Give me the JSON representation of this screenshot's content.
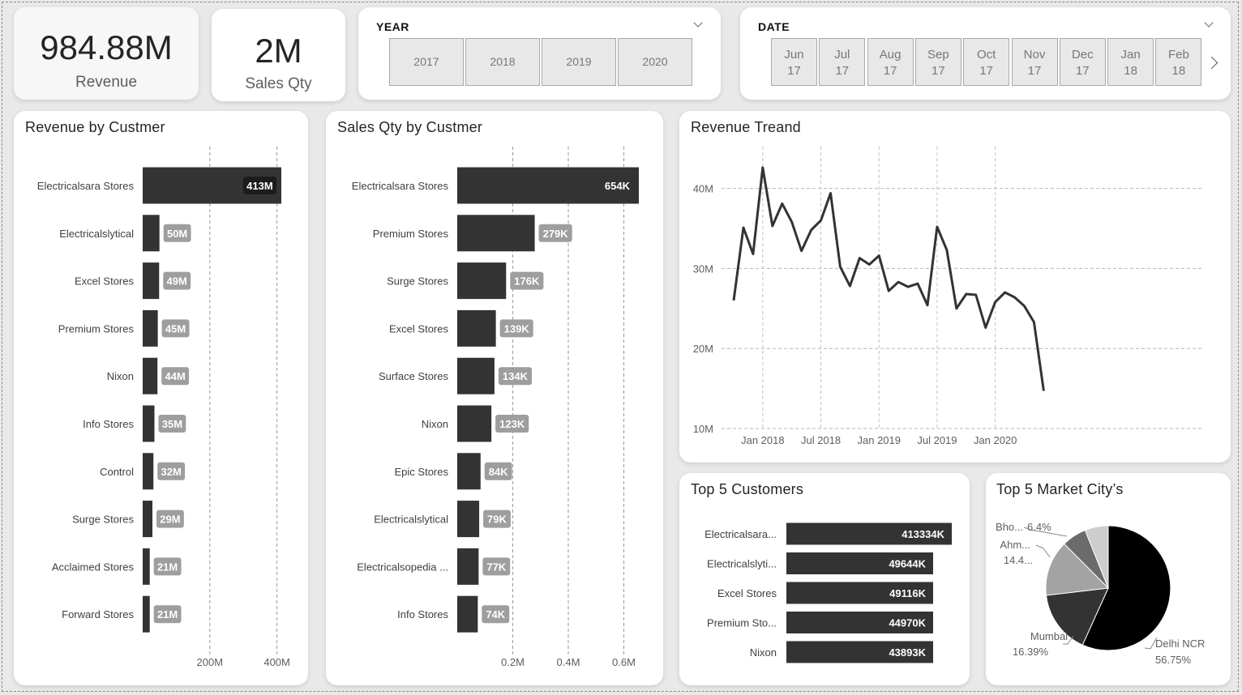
{
  "kpis": {
    "revenue": {
      "value": "984.88M",
      "label": "Revenue"
    },
    "sales_qty": {
      "value": "2M",
      "label": "Sales Qty"
    }
  },
  "year_slicer": {
    "title": "YEAR",
    "options": [
      "2017",
      "2018",
      "2019",
      "2020"
    ]
  },
  "date_slicer": {
    "title": "DATE",
    "options": [
      {
        "month": "Jun",
        "year": "17"
      },
      {
        "month": "Jul",
        "year": "17"
      },
      {
        "month": "Aug",
        "year": "17"
      },
      {
        "month": "Sep",
        "year": "17"
      },
      {
        "month": "Oct",
        "year": "17"
      },
      {
        "month": "Nov",
        "year": "17"
      },
      {
        "month": "Dec",
        "year": "17"
      },
      {
        "month": "Jan",
        "year": "18"
      },
      {
        "month": "Feb",
        "year": "18"
      }
    ]
  },
  "colors": {
    "bar": "#333333",
    "label_bg": "#9e9e9e",
    "pie_dark": "#000000"
  },
  "chart_data": [
    {
      "id": "revenue_by_customer",
      "type": "bar",
      "orientation": "horizontal",
      "title": "Revenue by Custmer",
      "categories": [
        "Electricalsara Stores",
        "Electricalslytical",
        "Excel Stores",
        "Premium Stores",
        "Nixon",
        "Info Stores",
        "Control",
        "Surge Stores",
        "Acclaimed Stores",
        "Forward Stores"
      ],
      "values": [
        413,
        50,
        49,
        45,
        44,
        35,
        32,
        29,
        21,
        21
      ],
      "value_labels": [
        "413M",
        "50M",
        "49M",
        "45M",
        "44M",
        "35M",
        "32M",
        "29M",
        "21M",
        "21M"
      ],
      "unit": "M",
      "xlim": [
        0,
        413
      ],
      "xticks": [
        {
          "v": 200,
          "label": "200M"
        },
        {
          "v": 400,
          "label": "400M"
        }
      ],
      "grid": true
    },
    {
      "id": "sales_qty_by_customer",
      "type": "bar",
      "orientation": "horizontal",
      "title": "Sales Qty by Custmer",
      "categories": [
        "Electricalsara Stores",
        "Premium Stores",
        "Surge Stores",
        "Excel Stores",
        "Surface Stores",
        "Nixon",
        "Epic Stores",
        "Electricalslytical",
        "Electricalsopedia ...",
        "Info Stores"
      ],
      "values": [
        654,
        279,
        176,
        139,
        134,
        123,
        84,
        79,
        77,
        74
      ],
      "value_labels": [
        "654K",
        "279K",
        "176K",
        "139K",
        "134K",
        "123K",
        "84K",
        "79K",
        "77K",
        "74K"
      ],
      "unit": "K",
      "xlim": [
        0,
        654
      ],
      "xticks": [
        {
          "v": 200,
          "label": "0.2M"
        },
        {
          "v": 400,
          "label": "0.4M"
        },
        {
          "v": 600,
          "label": "0.6M"
        }
      ],
      "grid": true
    },
    {
      "id": "revenue_trend",
      "type": "line",
      "title": "Revenue Treand",
      "x": [
        "2017-10",
        "2017-11",
        "2017-12",
        "2018-01",
        "2018-02",
        "2018-03",
        "2018-04",
        "2018-05",
        "2018-06",
        "2018-07",
        "2018-08",
        "2018-09",
        "2018-10",
        "2018-11",
        "2018-12",
        "2019-01",
        "2019-02",
        "2019-03",
        "2019-04",
        "2019-05",
        "2019-06",
        "2019-07",
        "2019-08",
        "2019-09",
        "2019-10",
        "2019-11",
        "2019-12",
        "2020-01",
        "2020-02",
        "2020-03",
        "2020-04",
        "2020-05",
        "2020-06"
      ],
      "y": [
        26.0,
        35.1,
        31.8,
        42.6,
        35.3,
        38.1,
        35.8,
        32.2,
        34.8,
        36.0,
        39.4,
        30.2,
        27.8,
        31.3,
        30.5,
        31.6,
        27.2,
        28.3,
        27.7,
        28.1,
        25.4,
        35.2,
        32.3,
        25.0,
        26.8,
        26.7,
        22.6,
        25.8,
        27.0,
        26.4,
        25.3,
        23.3,
        14.7
      ],
      "ylim": [
        10,
        45
      ],
      "yticks": [
        {
          "v": 10,
          "label": "10M"
        },
        {
          "v": 20,
          "label": "20M"
        },
        {
          "v": 30,
          "label": "30M"
        },
        {
          "v": 40,
          "label": "40M"
        }
      ],
      "xticks": [
        {
          "v": "2018-01",
          "label": "Jan 2018"
        },
        {
          "v": "2018-07",
          "label": "Jul 2018"
        },
        {
          "v": "2019-01",
          "label": "Jan 2019"
        },
        {
          "v": "2019-07",
          "label": "Jul 2019"
        },
        {
          "v": "2020-01",
          "label": "Jan 2020"
        }
      ],
      "unit": "M",
      "grid": true
    },
    {
      "id": "top5_customers",
      "type": "bar",
      "orientation": "horizontal",
      "title": "Top 5 Customers",
      "categories": [
        "Electricalsara...",
        "Electricalslyti...",
        "Excel Stores",
        "Premium Sto...",
        "Nixon"
      ],
      "values": [
        413334,
        49644,
        49116,
        44970,
        43893
      ],
      "value_labels": [
        "413334K",
        "49644K",
        "49116K",
        "44970K",
        "43893K"
      ],
      "unit": "K"
    },
    {
      "id": "top5_market_city",
      "type": "pie",
      "title": "Top 5 Market City’s",
      "slices": [
        {
          "label": "Delhi NCR",
          "pct_label": "56.75%",
          "value": 56.75,
          "color": "#000000"
        },
        {
          "label": "Mumbai",
          "pct_label": "16.39%",
          "value": 16.39,
          "color": "#333333"
        },
        {
          "label": "Ahm...",
          "pct_label": "14.4...",
          "value": 14.4,
          "color": "#a3a3a3"
        },
        {
          "label": "Bho...",
          "pct_label": "6.4%",
          "value": 6.4,
          "color": "#6b6b6b"
        },
        {
          "label": "",
          "pct_label": "",
          "value": 6.06,
          "color": "#cdcdcd"
        }
      ]
    }
  ]
}
